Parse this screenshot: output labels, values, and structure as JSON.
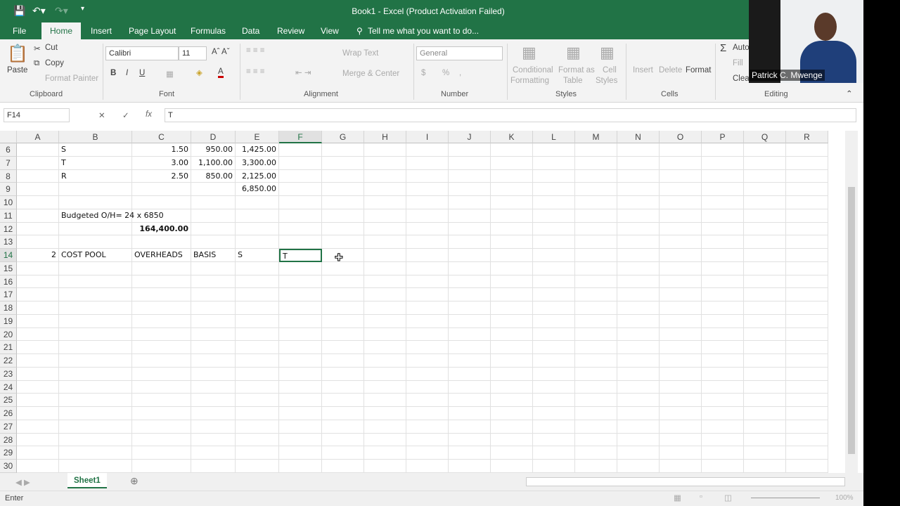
{
  "window": {
    "title": "Book1 - Excel (Product Activation Failed)"
  },
  "tabs": [
    "File",
    "Home",
    "Insert",
    "Page Layout",
    "Formulas",
    "Data",
    "Review",
    "View"
  ],
  "tell_me": "Tell me what you want to do...",
  "clipboard": {
    "paste": "Paste",
    "cut": "Cut",
    "copy": "Copy",
    "format_painter": "Format Painter",
    "label": "Clipboard"
  },
  "font": {
    "name": "Calibri",
    "size": "11",
    "bold": "B",
    "italic": "I",
    "underline": "U",
    "label": "Font"
  },
  "alignment": {
    "wrap": "Wrap Text",
    "merge": "Merge & Center",
    "label": "Alignment"
  },
  "number": {
    "format": "General",
    "currency": "$",
    "percent": "%",
    "comma": ",",
    "label": "Number"
  },
  "styles": {
    "conditional": "Conditional",
    "conditional2": "Formatting",
    "format_table": "Format as",
    "format_table2": "Table",
    "cell_styles": "Cell",
    "cell_styles2": "Styles",
    "label": "Styles"
  },
  "cells": {
    "insert": "Insert",
    "delete": "Delete",
    "format": "Format",
    "label": "Cells"
  },
  "editing": {
    "autosum": "Auto",
    "fill": "Fill",
    "clear": "Clea",
    "label": "Editing"
  },
  "formula_bar": {
    "name_box": "F14",
    "fx": "fx",
    "value": "T"
  },
  "columns": [
    "A",
    "B",
    "C",
    "D",
    "E",
    "F",
    "G",
    "H",
    "I",
    "J",
    "K",
    "L",
    "M",
    "N",
    "O",
    "P",
    "Q",
    "R"
  ],
  "selected_cell": "F14",
  "rows": [
    {
      "n": "6",
      "cells": {
        "B": "S",
        "C": "1.50",
        "D": "950.00",
        "E": "1,425.00"
      }
    },
    {
      "n": "7",
      "cells": {
        "B": "T",
        "C": "3.00",
        "D": "1,100.00",
        "E": "3,300.00"
      }
    },
    {
      "n": "8",
      "cells": {
        "B": "R",
        "C": "2.50",
        "D": "850.00",
        "E": "2,125.00"
      }
    },
    {
      "n": "9",
      "cells": {
        "E": "6,850.00"
      }
    },
    {
      "n": "10",
      "cells": {}
    },
    {
      "n": "11",
      "cells": {
        "B": "Budgeted O/H= 24 x 6850"
      }
    },
    {
      "n": "12",
      "cells": {
        "C": "164,400.00"
      }
    },
    {
      "n": "13",
      "cells": {}
    },
    {
      "n": "14",
      "cells": {
        "A": "2",
        "B": "COST POOL",
        "C": "OVERHEADS",
        "D": "BASIS",
        "E": "S",
        "F": "T"
      }
    },
    {
      "n": "15",
      "cells": {}
    },
    {
      "n": "16",
      "cells": {}
    },
    {
      "n": "17",
      "cells": {}
    },
    {
      "n": "18",
      "cells": {}
    },
    {
      "n": "19",
      "cells": {}
    },
    {
      "n": "20",
      "cells": {}
    },
    {
      "n": "21",
      "cells": {}
    },
    {
      "n": "22",
      "cells": {}
    },
    {
      "n": "23",
      "cells": {}
    },
    {
      "n": "24",
      "cells": {}
    },
    {
      "n": "25",
      "cells": {}
    },
    {
      "n": "26",
      "cells": {}
    },
    {
      "n": "27",
      "cells": {}
    },
    {
      "n": "28",
      "cells": {}
    },
    {
      "n": "29",
      "cells": {}
    },
    {
      "n": "30",
      "cells": {}
    }
  ],
  "sheet_tabs": [
    "Sheet1"
  ],
  "status": {
    "mode": "Enter",
    "zoom": "100%"
  },
  "webcam": {
    "name": "Patrick C. Mwenge"
  },
  "colors": {
    "accent": "#217346"
  }
}
